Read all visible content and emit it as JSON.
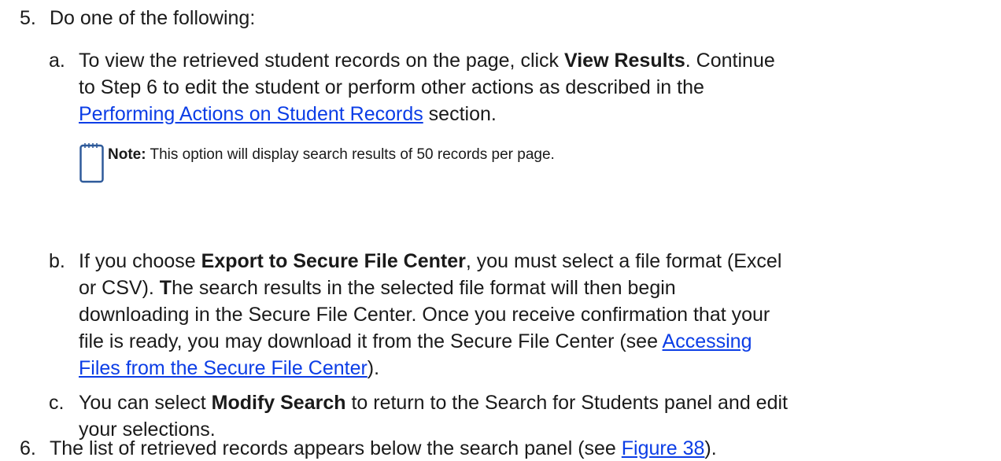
{
  "step5": {
    "number": "5.",
    "text": "Do one of the following:"
  },
  "item_a": {
    "letter": "a.",
    "line1_pre": "To view the retrieved student records on the page, click ",
    "line1_bold": "View Results",
    "line1_post": ". Continue",
    "line2": "to Step 6 to edit the student or perform other actions as described in the",
    "link": "Performing Actions on Student Records",
    "line3_post": " section."
  },
  "note": {
    "label": "Note:",
    "text": " This option will display search results of 50 records per page."
  },
  "item_b": {
    "letter": "b.",
    "line1_pre": "If you choose ",
    "line1_bold": "Export to Secure File Center",
    "line1_post": ", you must select a file format (Excel",
    "line2_pre": "or CSV). ",
    "line2_bold": "T",
    "line2_post": "he search results in the selected file format will then begin",
    "line3": "downloading in the Secure File Center. Once you receive confirmation that your",
    "line4_pre": "file is ready, you may download it from the Secure File Center (see ",
    "link_part1": "Accessing",
    "link_part2": "Files from the Secure File Center",
    "line5_post": ")."
  },
  "item_c": {
    "letter": "c.",
    "line1_pre": "You can select ",
    "line1_bold": "Modify Search",
    "line1_post": " to return to the Search for Students panel and edit",
    "line2": "your selections."
  },
  "step6": {
    "number": "6.",
    "text_pre": "The list of retrieved records appears below the search panel (see ",
    "link": "Figure 38",
    "text_post": ")."
  },
  "colors": {
    "link": "#0b3de6",
    "note_icon": "#2e5a9a"
  },
  "icons": {
    "note": "notepad-icon"
  }
}
